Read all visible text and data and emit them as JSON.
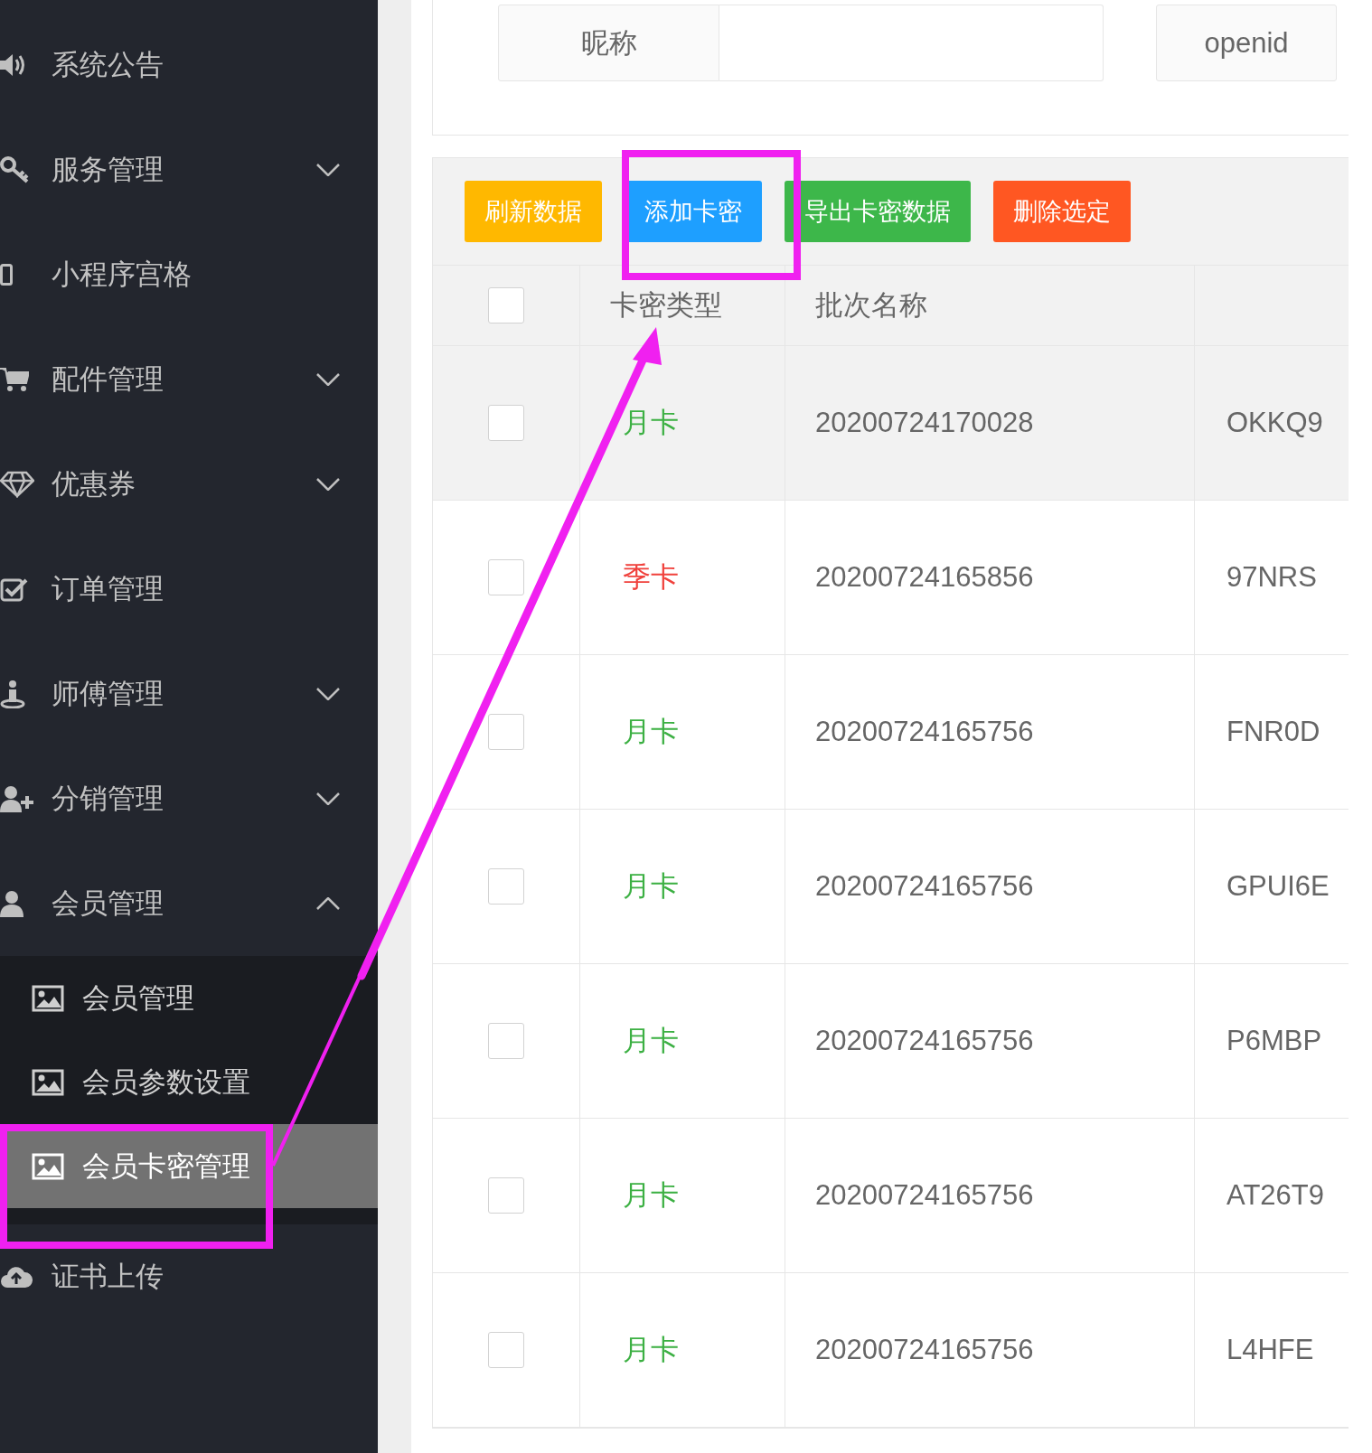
{
  "sidebar": {
    "items": [
      {
        "label": "系统公告"
      },
      {
        "label": "服务管理",
        "expanded": false
      },
      {
        "label": "小程序宫格"
      },
      {
        "label": "配件管理",
        "expanded": false
      },
      {
        "label": "优惠券",
        "expanded": false
      },
      {
        "label": "订单管理"
      },
      {
        "label": "师傅管理",
        "expanded": false
      },
      {
        "label": "分销管理",
        "expanded": false
      },
      {
        "label": "会员管理",
        "expanded": true,
        "children": [
          {
            "label": "会员管理",
            "selected": false
          },
          {
            "label": "会员参数设置",
            "selected": false
          },
          {
            "label": "会员卡密管理",
            "selected": true
          }
        ]
      },
      {
        "label": "证书上传"
      }
    ]
  },
  "search": {
    "fields": [
      {
        "label": "昵称"
      },
      {
        "label": "openid"
      }
    ]
  },
  "toolbar": {
    "buttons": [
      {
        "label": "刷新数据",
        "color": "#ffb800"
      },
      {
        "label": "添加卡密",
        "color": "#1e9fff"
      },
      {
        "label": "导出卡密数据",
        "color": "#3db74a"
      },
      {
        "label": "删除选定",
        "color": "#ff5722"
      }
    ]
  },
  "table": {
    "header_checked": false,
    "columns": [
      "卡密类型",
      "批次名称"
    ],
    "rows": [
      {
        "checked": false,
        "hovered": true,
        "type": "月卡",
        "color": "#3cb043",
        "batch": "20200724170028",
        "column_3": "OKKQ9"
      },
      {
        "checked": false,
        "hovered": false,
        "type": "季卡",
        "color": "#f0413c",
        "batch": "20200724165856",
        "column_3": "97NRS"
      },
      {
        "checked": false,
        "hovered": false,
        "type": "月卡",
        "color": "#3cb043",
        "batch": "20200724165756",
        "column_3": "FNR0D"
      },
      {
        "checked": false,
        "hovered": false,
        "type": "月卡",
        "color": "#3cb043",
        "batch": "20200724165756",
        "column_3": "GPUI6E"
      },
      {
        "checked": false,
        "hovered": false,
        "type": "月卡",
        "color": "#3cb043",
        "batch": "20200724165756",
        "column_3": "P6MBP"
      },
      {
        "checked": false,
        "hovered": false,
        "type": "月卡",
        "color": "#3cb043",
        "batch": "20200724165756",
        "column_3": "AT26T9"
      },
      {
        "checked": false,
        "hovered": false,
        "type": "月卡",
        "color": "#3cb043",
        "batch": "20200724165756",
        "column_3": "L4HFE"
      }
    ]
  },
  "annotations": [
    {
      "kind": "frame"
    },
    {
      "kind": "frame"
    },
    {
      "kind": "arrow"
    }
  ]
}
